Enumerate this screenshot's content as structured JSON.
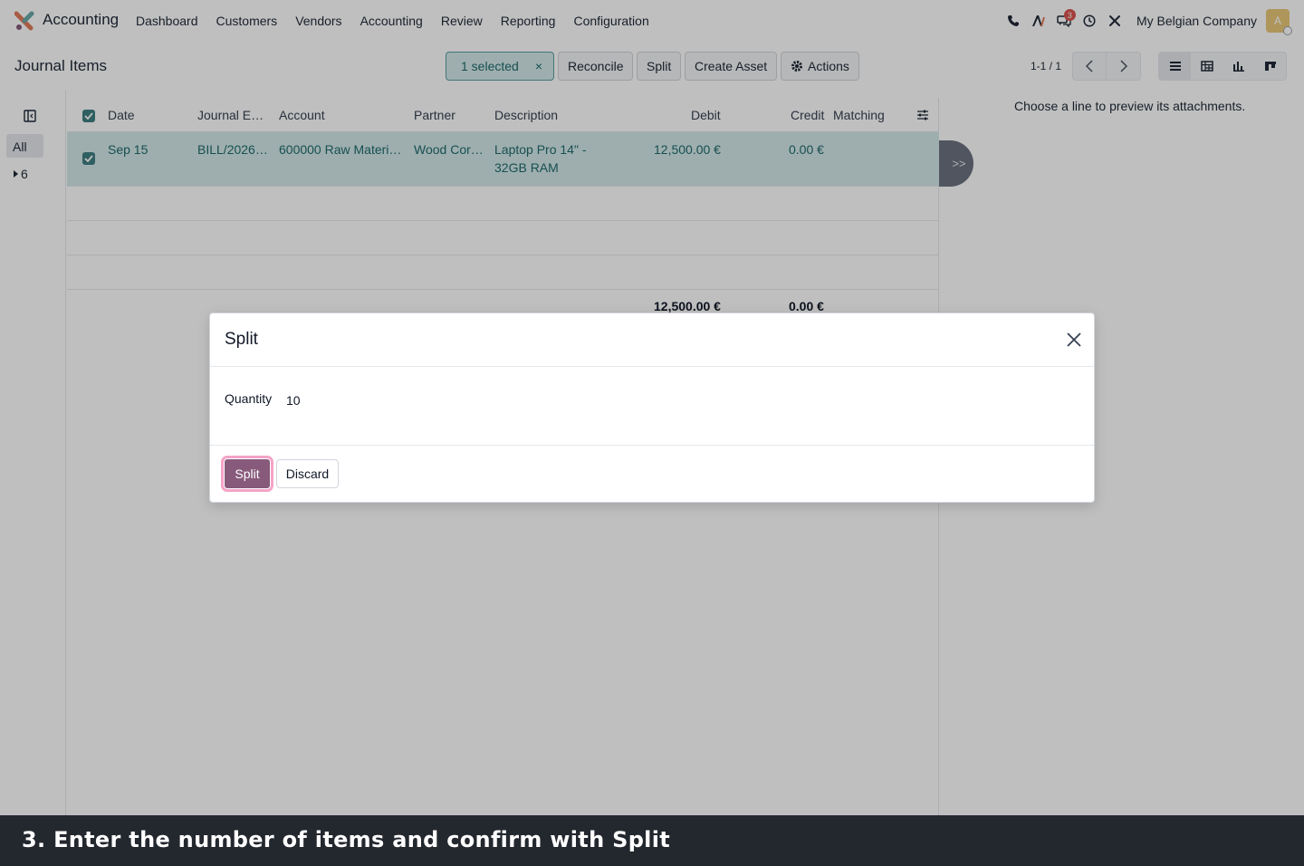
{
  "app": {
    "name": "Accounting"
  },
  "menu": [
    "Dashboard",
    "Customers",
    "Vendors",
    "Accounting",
    "Review",
    "Reporting",
    "Configuration"
  ],
  "systray": {
    "chat_badge": "3",
    "company": "My Belgian Company",
    "avatar_letter": "A"
  },
  "control_panel": {
    "title": "Journal Items",
    "selected_label": "1 selected",
    "clear_symbol": "×",
    "reconcile": "Reconcile",
    "split": "Split",
    "create_asset": "Create Asset",
    "actions": "Actions",
    "pager": "1-1 / 1"
  },
  "side_panel": {
    "all": "All",
    "count": "6"
  },
  "list": {
    "headers": {
      "date": "Date",
      "journal_entry": "Journal E…",
      "account": "Account",
      "partner": "Partner",
      "description": "Description",
      "debit": "Debit",
      "credit": "Credit",
      "matching": "Matching"
    },
    "row": {
      "date": "Sep 15",
      "journal_entry": "BILL/2026…",
      "account": "600000 Raw Materi…",
      "partner": "Wood Cor…",
      "description_line1": "Laptop Pro 14\" -",
      "description_line2": "32GB RAM",
      "debit": "12,500.00 €",
      "credit": "0.00 €"
    },
    "totals": {
      "debit": "12,500.00 €",
      "credit": "0.00 €"
    }
  },
  "expand_label": ">>",
  "preview_text": "Choose a line to preview its attachments.",
  "modal": {
    "title": "Split",
    "quantity_label": "Quantity",
    "quantity_value": "10",
    "split_button": "Split",
    "discard_button": "Discard"
  },
  "caption": "3. Enter the number of items and confirm with Split",
  "colors": {
    "primary": "#875a7b",
    "selected_row": "#d3e9e9",
    "accent_teal": "#3f7f82",
    "caption_bg": "#23272e"
  }
}
